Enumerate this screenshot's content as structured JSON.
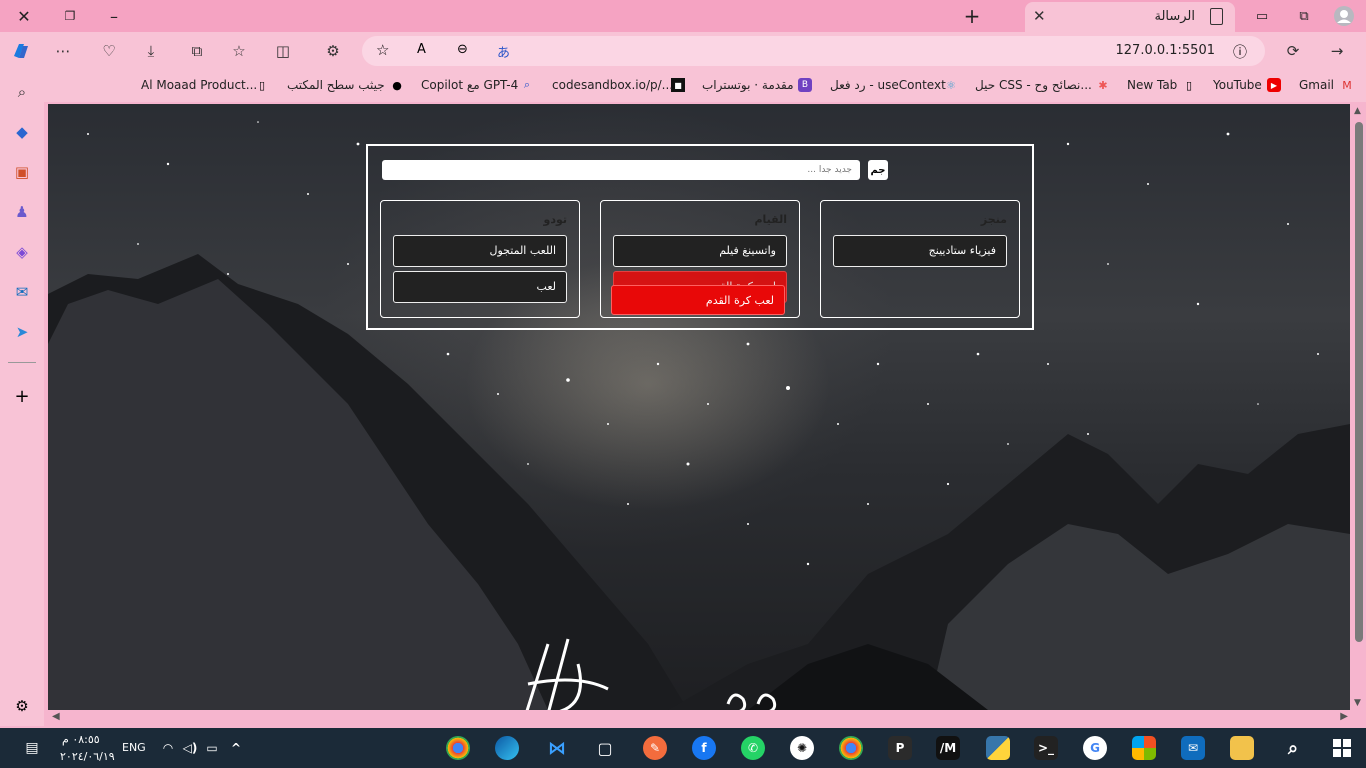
{
  "browser": {
    "tab_title": "الرسالة",
    "url": "127.0.0.1:5501"
  },
  "bookmarks": [
    {
      "label": "Gmail"
    },
    {
      "label": "YouTube"
    },
    {
      "label": "New Tab"
    },
    {
      "label": "حيل CSS - نصائح وح..."
    },
    {
      "label": "رد فعل - useContext"
    },
    {
      "label": "مقدمة · بوتستراب"
    },
    {
      "label": "codesandbox.io/p/..."
    },
    {
      "label": "Copilot مع GPT-4"
    },
    {
      "label": "جيثب سطح المكتب"
    },
    {
      "label": "Al Moaad Product..."
    }
  ],
  "app": {
    "add_label": "جم",
    "input_placeholder": "جديد جدا ...",
    "columns": [
      {
        "title": "منجز",
        "cards": [
          "فيزياء ستاديينج"
        ]
      },
      {
        "title": "القيام",
        "cards": [
          "واتسينغ فيلم",
          "لعب كرة القدم"
        ],
        "dragging": "لعب كرة القدم"
      },
      {
        "title": "تودو",
        "cards": [
          "اللعب المتجول",
          "لعب"
        ]
      }
    ]
  },
  "taskbar": {
    "time": "٠٨:٥٥ م",
    "date": "٢٠٢٤/٠٦/١٩",
    "lang": "ENG"
  },
  "colors": {
    "card_bg": "#222222",
    "drag_red": "#ee0a0a",
    "browser_pink": "#f8c3d6"
  }
}
